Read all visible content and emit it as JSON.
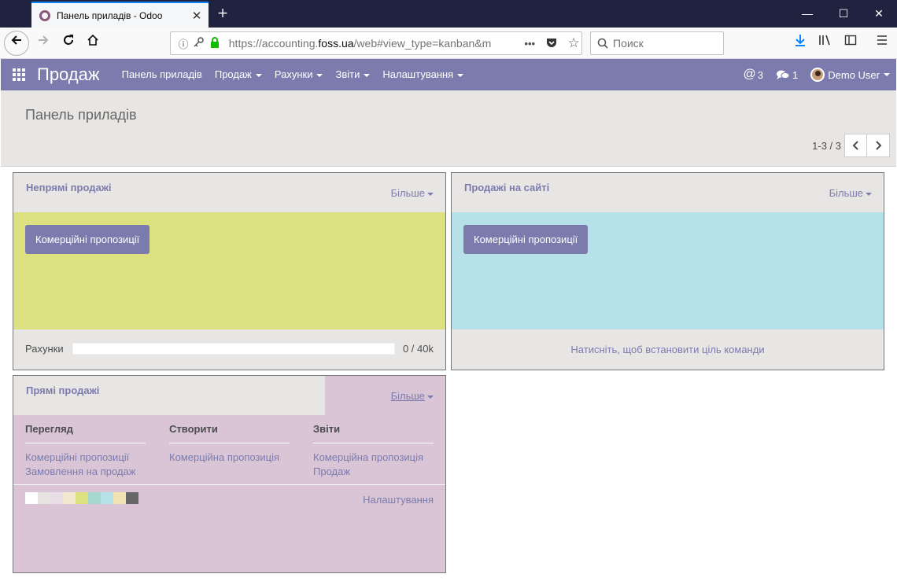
{
  "browser": {
    "tab_title": "Панель приладів - Odoo",
    "url_prefix": "https://accounting.",
    "url_domain": "foss.ua",
    "url_rest": "/web#view_type=kanban&m",
    "search_placeholder": "Поиск"
  },
  "odoo_nav": {
    "brand": "Продаж",
    "menu": [
      {
        "label": "Панель приладів",
        "dropdown": false
      },
      {
        "label": "Продаж",
        "dropdown": true
      },
      {
        "label": "Рахунки",
        "dropdown": true
      },
      {
        "label": "Звіти",
        "dropdown": true
      },
      {
        "label": "Налаштування",
        "dropdown": true
      }
    ],
    "mentions_count": "3",
    "messages_count": "1",
    "user_name": "Demo User"
  },
  "control_panel": {
    "breadcrumb": "Панель приладів",
    "pager": "1-3 / 3"
  },
  "cards": [
    {
      "title": "Непрямі продажі",
      "more": "Більше",
      "button": "Комерційні пропозиції",
      "color": "#dde07f",
      "target_label": "Рахунки",
      "target_value": "0 / 40k",
      "target_fraction": 0
    },
    {
      "title": "Продажі на сайті",
      "more": "Більше",
      "button": "Комерційні пропозиції",
      "color": "#b6e1e8",
      "set_target": "Натисніть, щоб встановити ціль команди"
    },
    {
      "title": "Прямі продажі",
      "more": "Більше",
      "color": "#d9c5d6",
      "columns": [
        {
          "title": "Перегляд",
          "links": [
            "Комерційні пропозиції",
            "Замовлення на продаж"
          ]
        },
        {
          "title": "Створити",
          "links": [
            "Комерційна пропозиція"
          ]
        },
        {
          "title": "Звіти",
          "links": [
            "Комерційна пропозиція",
            "Продаж"
          ]
        }
      ],
      "swatch_colors": [
        "#ffffff",
        "#e6e3e3",
        "#e9dde6",
        "#f2e8cf",
        "#dde07f",
        "#a7d8cf",
        "#b6e1e8",
        "#f1e3b2",
        "#666666"
      ],
      "settings": "Налаштування"
    }
  ]
}
